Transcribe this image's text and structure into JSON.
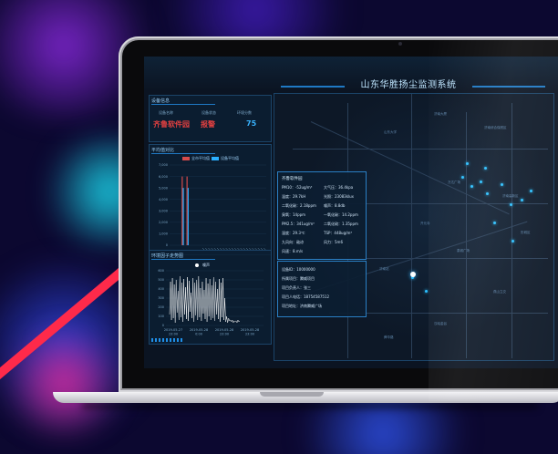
{
  "app": {
    "title": "山东华胜扬尘监测系统"
  },
  "device_info": {
    "heading": "设备信息",
    "labels": [
      "设备名称",
      "设备状态",
      "环境分数"
    ],
    "values": [
      "齐鲁软件园",
      "报警",
      "75"
    ]
  },
  "avg_panel": {
    "heading": "平均值对比",
    "legend": [
      "全市平均值",
      "设备平均值"
    ]
  },
  "trend_panel": {
    "heading": "环境因子走势图",
    "legend": "噪声"
  },
  "popup": {
    "title": "齐鲁软件园",
    "lines": [
      [
        "PM10：-52ug/m³",
        "大气压：36.4kpa"
      ],
      [
        "温度：29.7kH",
        "光照：23083klux"
      ],
      [
        "二氧化碳：2.18ppm",
        "噪声：8.8db"
      ],
      [
        "臭氧：14ppm",
        "一氧化碳：14.2ppm"
      ],
      [
        "PM2.5：341ug/m³",
        "二氧化硫：1.35ppm"
      ],
      [
        "湿度：29.3℃",
        "TSP：448ug/m³"
      ],
      [
        "九风向：敌谅",
        "风力：5m6"
      ],
      [
        "风速：8.m/s",
        ""
      ]
    ],
    "device": [
      "设备ID：10000000",
      "所属项目：腾威项目",
      "项目负责人：张三",
      "项目人电话：18754587512",
      "项目地址：济南腾威广场"
    ]
  },
  "map_labels": [
    "济南大厦",
    "济南综合保税区",
    "万达广场",
    "山东大学",
    "济南高新区",
    "历城区",
    "开元寺",
    "泉城广场",
    "济南站",
    "燕山立交",
    "汉峪金谷",
    "舜华路"
  ],
  "chart_data": [
    {
      "type": "bar",
      "yticks": [
        "7,000",
        "6,000",
        "5,000",
        "4,000",
        "3,000",
        "2,000",
        "1,000",
        "0"
      ],
      "ylim": [
        0,
        7000
      ],
      "series": [
        {
          "name": "全市平均值",
          "color": "#d64b4b",
          "values": [
            0,
            0,
            0,
            0,
            0,
            6000,
            0,
            6000,
            0,
            0,
            0,
            0,
            0,
            0,
            0,
            0,
            0,
            0,
            0,
            0,
            0,
            0,
            0,
            0,
            0,
            0,
            0,
            0,
            0,
            0,
            0,
            0,
            0,
            0,
            0,
            0,
            0,
            0,
            0,
            0
          ]
        },
        {
          "name": "设备平均值",
          "color": "#2bb0ff",
          "values": [
            0,
            0,
            0,
            0,
            0,
            5000,
            0,
            5000,
            0,
            0,
            0,
            0,
            0,
            0,
            0,
            0,
            0,
            0,
            0,
            0,
            0,
            0,
            0,
            0,
            0,
            0,
            0,
            0,
            0,
            0,
            0,
            0,
            0,
            0,
            0,
            0,
            0,
            0,
            0,
            0
          ]
        }
      ]
    },
    {
      "type": "line",
      "yticks": [
        "600",
        "500",
        "400",
        "300",
        "200",
        "100",
        "0"
      ],
      "ylim": [
        0,
        600
      ],
      "xticks": [
        "2019-05-27\n23:00",
        "2019-05-28\n0:00",
        "2019-05-28\n23:00",
        "2019-05-28\n23:00"
      ],
      "series": [
        {
          "name": "噪声",
          "color": "#ffffff",
          "values": [
            120,
            480,
            60,
            520,
            80,
            450,
            30,
            500,
            140,
            380,
            60,
            540,
            90,
            470,
            40,
            510,
            120,
            420,
            70,
            530,
            50,
            490,
            150,
            360,
            80,
            520,
            40,
            470,
            110,
            500,
            60,
            540,
            90,
            410,
            50,
            480,
            130,
            390,
            70,
            520,
            40,
            460,
            100,
            510,
            60,
            440,
            80,
            530,
            50,
            480,
            120,
            400,
            70,
            510,
            40,
            470,
            90,
            520,
            60,
            300,
            40,
            100,
            30,
            80,
            50,
            60,
            40,
            60,
            30,
            50,
            40,
            50,
            30,
            60,
            40,
            50
          ]
        }
      ]
    }
  ]
}
